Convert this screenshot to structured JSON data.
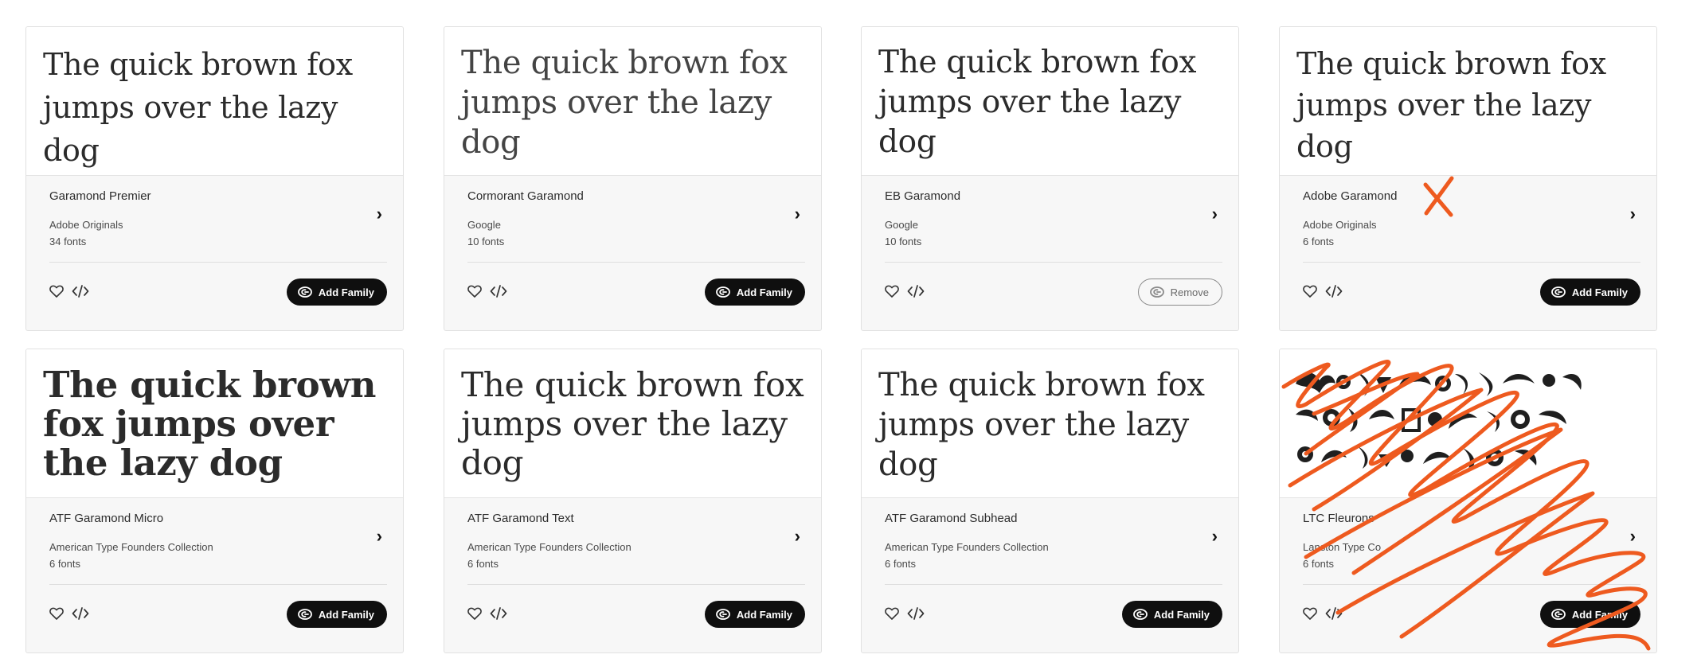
{
  "sample_text": "The quick brown fox jumps over the lazy dog",
  "colors": {
    "button_bg": "#0f0f0f",
    "annotation": "#ee5a1f",
    "card_bg": "#f7f7f7"
  },
  "icons": {
    "favorite": "heart-icon",
    "embed": "code-icon",
    "next": "chevron-right-icon",
    "creative_cloud": "creative-cloud-icon"
  },
  "cards": [
    {
      "name": "Garamond Premier",
      "foundry": "Adobe Originals",
      "count": "34 fonts",
      "button": "Add Family",
      "added": false
    },
    {
      "name": "Cormorant Garamond",
      "foundry": "Google",
      "count": "10 fonts",
      "button": "Add Family",
      "added": false
    },
    {
      "name": "EB Garamond",
      "foundry": "Google",
      "count": "10 fonts",
      "button": "Remove",
      "added": true
    },
    {
      "name": "Adobe Garamond",
      "foundry": "Adobe Originals",
      "count": "6 fonts",
      "button": "Add Family",
      "added": false
    },
    {
      "name": "ATF Garamond Micro",
      "foundry": "American Type Founders Collection",
      "count": "6 fonts",
      "button": "Add Family",
      "added": false
    },
    {
      "name": "ATF Garamond Text",
      "foundry": "American Type Founders Collection",
      "count": "6 fonts",
      "button": "Add Family",
      "added": false
    },
    {
      "name": "ATF Garamond Subhead",
      "foundry": "American Type Founders Collection",
      "count": "6 fonts",
      "button": "Add Family",
      "added": false
    },
    {
      "name": "LTC Fleurons",
      "foundry": "Lanston Type Co",
      "count": "6 fonts",
      "button": "Add Family",
      "added": false
    }
  ]
}
